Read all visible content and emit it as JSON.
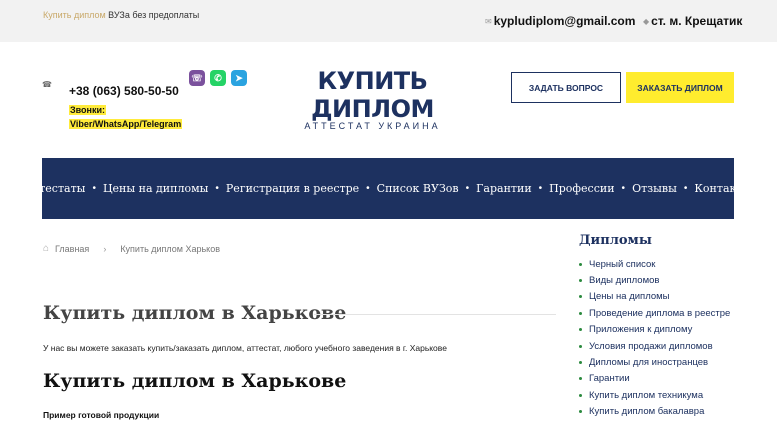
{
  "topbar": {
    "tagline_accent": "Купить диплом",
    "tagline_rest": " ВУЗа без предоплаты",
    "email": "kypludiplom@gmail.com",
    "metro": "ст. м. Крещатик"
  },
  "header": {
    "phone": "+38 (063) 580-50-50",
    "calls_label": "Звонки:",
    "calls_channels": "Viber/WhatsApp/Telegram",
    "logo_title": "КУПИТЬ ДИПЛОМ",
    "logo_subtitle": "АТТЕСТАТ УКРАИНА",
    "ask_button": "ЗАДАТЬ ВОПРОС",
    "order_button": "ЗАКАЗАТЬ ДИПЛОМ"
  },
  "nav": {
    "items": [
      "Аттестаты",
      "Цены на дипломы",
      "Регистрация в реестре",
      "Список ВУЗов",
      "Гарантии",
      "Профессии",
      "Отзывы",
      "Контакты"
    ],
    "separator": "•"
  },
  "breadcrumb": {
    "home": "Главная",
    "arrow": "›",
    "current": "Купить диплом Харьков"
  },
  "main": {
    "heading": "Купить диплом в Харькове",
    "intro": "У нас вы можете заказать купить/заказать диплом, аттестат, любого учебного заведения в г. Харькове",
    "heading2": "Купить диплом в Харькове",
    "sample_label": "Пример готовой продукции"
  },
  "sidebar": {
    "title": "Дипломы",
    "items": [
      "Черный список",
      "Виды дипломов",
      "Цены на дипломы",
      "Проведение диплома в реестре",
      "Приложения к диплому",
      "Условия продажи дипломов",
      "Дипломы для иностранцев",
      "Гарантии",
      "Купить диплом техникума",
      "Купить диплом бакалавра"
    ]
  },
  "icons": {
    "email": "envelope-icon",
    "metro": "location-pin-icon",
    "phone": "phone-icon",
    "home": "home-icon"
  },
  "colors": {
    "brand": "#1d3160",
    "accent_yellow": "#ffec2e",
    "tagline_accent": "#c9a96a"
  }
}
